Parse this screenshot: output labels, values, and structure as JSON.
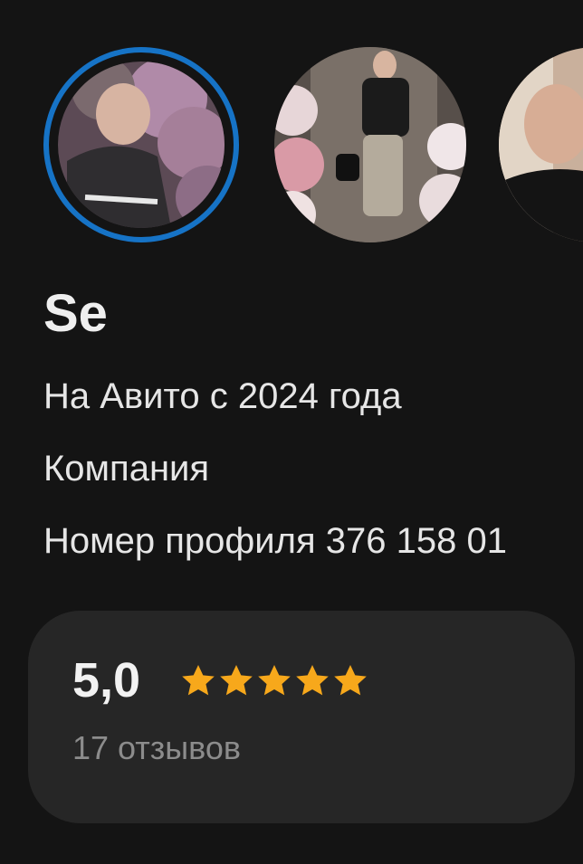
{
  "profile": {
    "name": "Se",
    "info_lines": [
      "На Авито с 2024 года",
      "Компания",
      "Номер профиля 376 158 01"
    ]
  },
  "stories": [
    {
      "label": "story-photo-1",
      "active": true
    },
    {
      "label": "story-photo-2",
      "active": false
    },
    {
      "label": "story-photo-3",
      "active": false
    }
  ],
  "rating": {
    "value": "5,0",
    "stars_filled": 5,
    "stars_total": 5,
    "reviews": "17 отзывов"
  },
  "colors": {
    "background": "#141414",
    "card": "#262626",
    "active_story_ring": "#1673c6",
    "star": "#f7a81b",
    "muted_text": "#8c8c8c"
  },
  "icons": {
    "star": "star-icon"
  }
}
